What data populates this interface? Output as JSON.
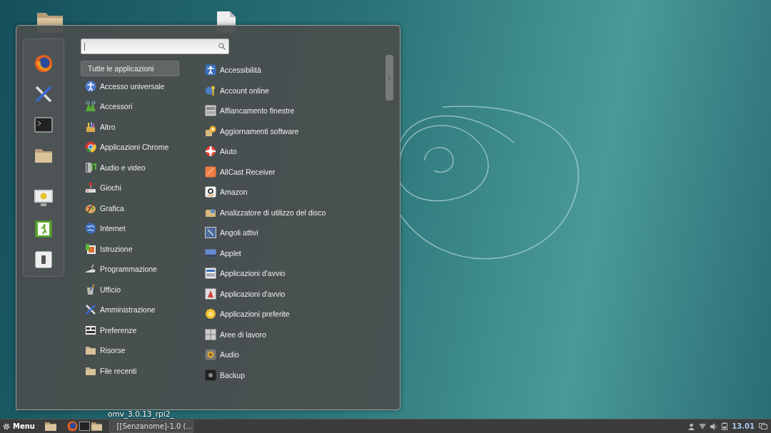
{
  "desktop": {
    "icons": [
      {
        "label": "omv_3.0.13_rpi2_"
      }
    ]
  },
  "menu": {
    "categories": [
      {
        "label": "Tutte le applicazioni",
        "selected": true
      },
      {
        "label": "Accesso universale",
        "selected": false
      },
      {
        "label": "Accessori",
        "selected": false
      },
      {
        "label": "Altro",
        "selected": false
      },
      {
        "label": "Applicazioni Chrome",
        "selected": false
      },
      {
        "label": "Audio e video",
        "selected": false
      },
      {
        "label": "Giochi",
        "selected": false
      },
      {
        "label": "Grafica",
        "selected": false
      },
      {
        "label": "Internet",
        "selected": false
      },
      {
        "label": "Istruzione",
        "selected": false
      },
      {
        "label": "Programmazione",
        "selected": false
      },
      {
        "label": "Ufficio",
        "selected": false
      },
      {
        "label": "Amministrazione",
        "selected": false
      },
      {
        "label": "Preferenze",
        "selected": false
      },
      {
        "label": "Risorse",
        "selected": false
      },
      {
        "label": "File recenti",
        "selected": false
      }
    ],
    "applications": [
      {
        "label": "Accessibilità"
      },
      {
        "label": "Account online"
      },
      {
        "label": "Affiancamento finestre"
      },
      {
        "label": "Aggiornamenti software"
      },
      {
        "label": "Aiuto"
      },
      {
        "label": "AllCast Receiver"
      },
      {
        "label": "Amazon"
      },
      {
        "label": "Analizzatore di utilizzo del disco"
      },
      {
        "label": "Angoli attivi"
      },
      {
        "label": "Applet"
      },
      {
        "label": "Applicazioni d'avvio"
      },
      {
        "label": "Applicazioni d'avvio"
      },
      {
        "label": "Applicazioni preferite"
      },
      {
        "label": "Aree di lavoro"
      },
      {
        "label": "Audio"
      },
      {
        "label": "Backup"
      }
    ]
  },
  "taskbar": {
    "menu_label": "Menu",
    "windows": [
      {
        "label": "[[Senzanome]-1.0 (..."
      }
    ],
    "clock": "13.01"
  }
}
